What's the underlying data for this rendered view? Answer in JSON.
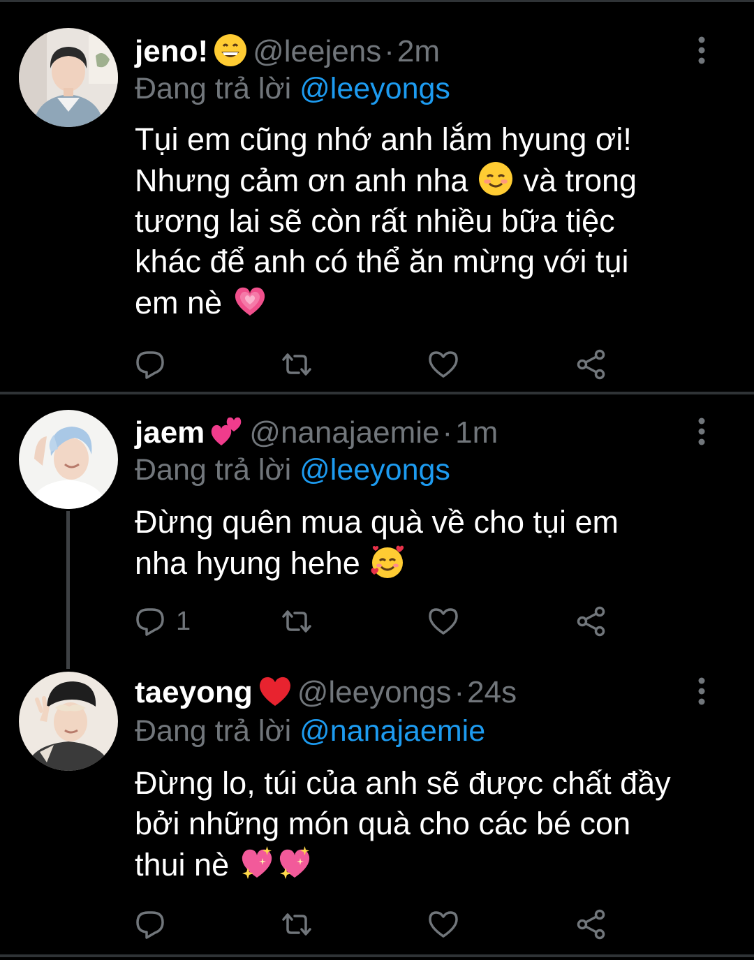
{
  "colors": {
    "background": "#000000",
    "divider": "#2f3336",
    "secondary_text": "#71767b",
    "link": "#1d9bf0",
    "primary_text": "#ffffff"
  },
  "tweets": [
    {
      "display_name": "jeno!",
      "name_emoji": "grinning-face-emoji",
      "handle": "@leejens",
      "separator": "·",
      "time": "2m",
      "reply_prefix": "Đang trả lời",
      "reply_to": "@leeyongs",
      "body_lines": [
        "Tụi em cũng nhớ anh lắm hyung ơi!",
        "Nhưng cảm ơn anh nha",
        "và trong",
        "tương lai sẽ còn rất nhiều bữa tiệc",
        "khác để anh có thể ăn mừng với tụi",
        "em nè"
      ],
      "body_emojis": [
        "smiling-face-emoji",
        "growing-heart-emoji"
      ],
      "reply_count": "",
      "icons": [
        "reply-icon",
        "retweet-icon",
        "like-icon",
        "share-icon",
        "more-icon"
      ]
    },
    {
      "display_name": "jaem",
      "name_emoji": "two-hearts-emoji",
      "handle": "@nanajaemie",
      "separator": "·",
      "time": "1m",
      "reply_prefix": "Đang trả lời",
      "reply_to": "@leeyongs",
      "body_lines": [
        "Đừng quên mua quà về cho tụi em",
        "nha hyung hehe"
      ],
      "body_emojis": [
        "smiling-face-with-hearts-emoji"
      ],
      "reply_count": "1",
      "icons": [
        "reply-icon",
        "retweet-icon",
        "like-icon",
        "share-icon",
        "more-icon"
      ]
    },
    {
      "display_name": "taeyong",
      "name_emoji": "red-heart-emoji",
      "handle": "@leeyongs",
      "separator": "·",
      "time": "24s",
      "reply_prefix": "Đang trả lời",
      "reply_to": "@nanajaemie",
      "body_lines": [
        "Đừng lo, túi của anh sẽ được chất đầy",
        "bởi những món quà cho các bé con",
        "thui nè"
      ],
      "body_emojis": [
        "sparkling-heart-emoji",
        "sparkling-heart-emoji"
      ],
      "reply_count": "",
      "icons": [
        "reply-icon",
        "retweet-icon",
        "like-icon",
        "share-icon",
        "more-icon"
      ]
    }
  ]
}
